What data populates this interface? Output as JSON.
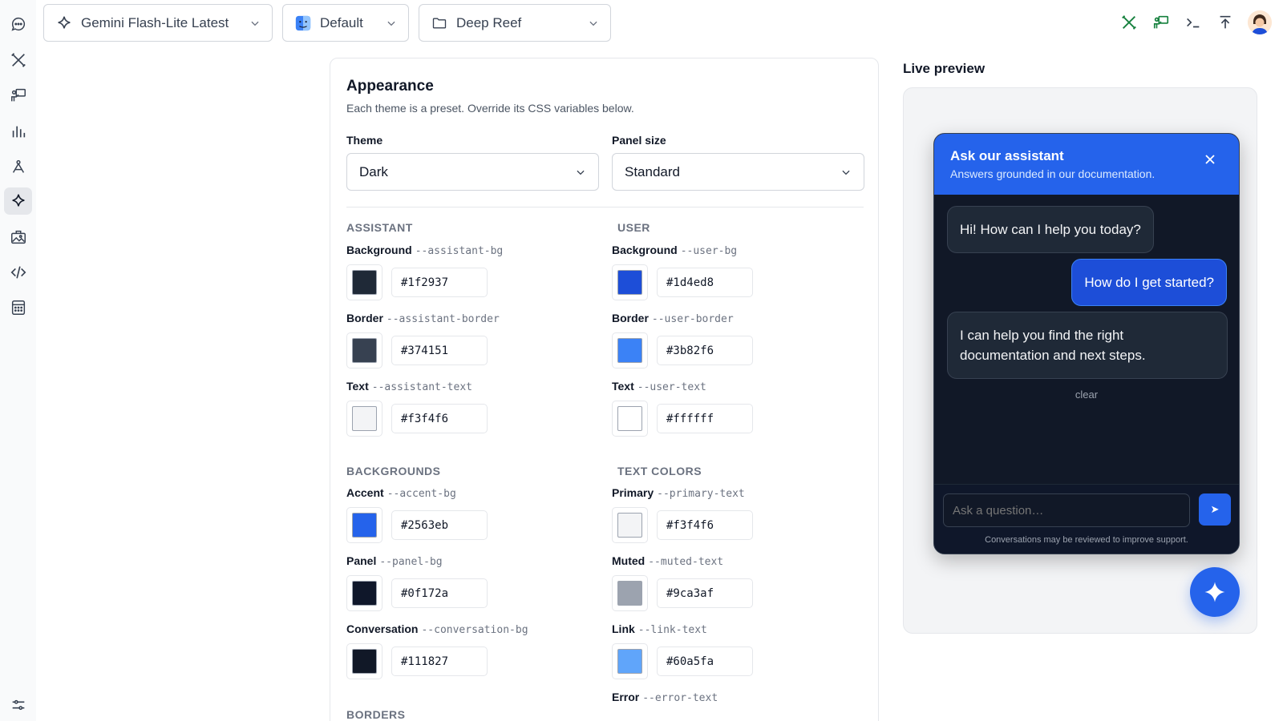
{
  "topbar": {
    "model": "Gemini Flash-Lite Latest",
    "profile": "Default",
    "project": "Deep Reef"
  },
  "rail": {
    "items": [
      "chat-icon",
      "tools-icon",
      "presentation-icon",
      "analytics-icon",
      "compass-icon",
      "sparkle-icon",
      "image-icon",
      "code-icon",
      "calculator-icon",
      "sliders-icon"
    ],
    "active": "sparkle-icon"
  },
  "appearance": {
    "title": "Appearance",
    "subtitle": "Each theme is a preset. Override its CSS variables below.",
    "theme_label": "Theme",
    "theme_value": "Dark",
    "size_label": "Panel size",
    "size_value": "Standard"
  },
  "sections": {
    "assistant": "ASSISTANT",
    "user": "USER",
    "backgrounds": "BACKGROUNDS",
    "text_colors": "TEXT COLORS",
    "borders": "BORDERS"
  },
  "vars": {
    "assistant_bg": {
      "name": "Background",
      "var": "--assistant-bg",
      "value": "#1f2937"
    },
    "assistant_border": {
      "name": "Border",
      "var": "--assistant-border",
      "value": "#374151"
    },
    "assistant_text": {
      "name": "Text",
      "var": "--assistant-text",
      "value": "#f3f4f6"
    },
    "user_bg": {
      "name": "Background",
      "var": "--user-bg",
      "value": "#1d4ed8"
    },
    "user_border": {
      "name": "Border",
      "var": "--user-border",
      "value": "#3b82f6"
    },
    "user_text": {
      "name": "Text",
      "var": "--user-text",
      "value": "#ffffff"
    },
    "accent_bg": {
      "name": "Accent",
      "var": "--accent-bg",
      "value": "#2563eb"
    },
    "panel_bg": {
      "name": "Panel",
      "var": "--panel-bg",
      "value": "#0f172a"
    },
    "conversation_bg": {
      "name": "Conversation",
      "var": "--conversation-bg",
      "value": "#111827"
    },
    "primary_text": {
      "name": "Primary",
      "var": "--primary-text",
      "value": "#f3f4f6"
    },
    "muted_text": {
      "name": "Muted",
      "var": "--muted-text",
      "value": "#9ca3af"
    },
    "link_text": {
      "name": "Link",
      "var": "--link-text",
      "value": "#60a5fa"
    },
    "error_text": {
      "name": "Error",
      "var": "--error-text"
    }
  },
  "preview": {
    "title": "Live preview",
    "widget_title": "Ask our assistant",
    "widget_subtitle": "Answers grounded in our documentation.",
    "msg_1": "Hi! How can I help you today?",
    "msg_2": "How do I get started?",
    "msg_3": "I can help you find the right documentation and next steps.",
    "clear": "clear",
    "input_placeholder": "Ask a question…",
    "send_glyph": "➤",
    "note": "Conversations may be reviewed to improve support."
  }
}
